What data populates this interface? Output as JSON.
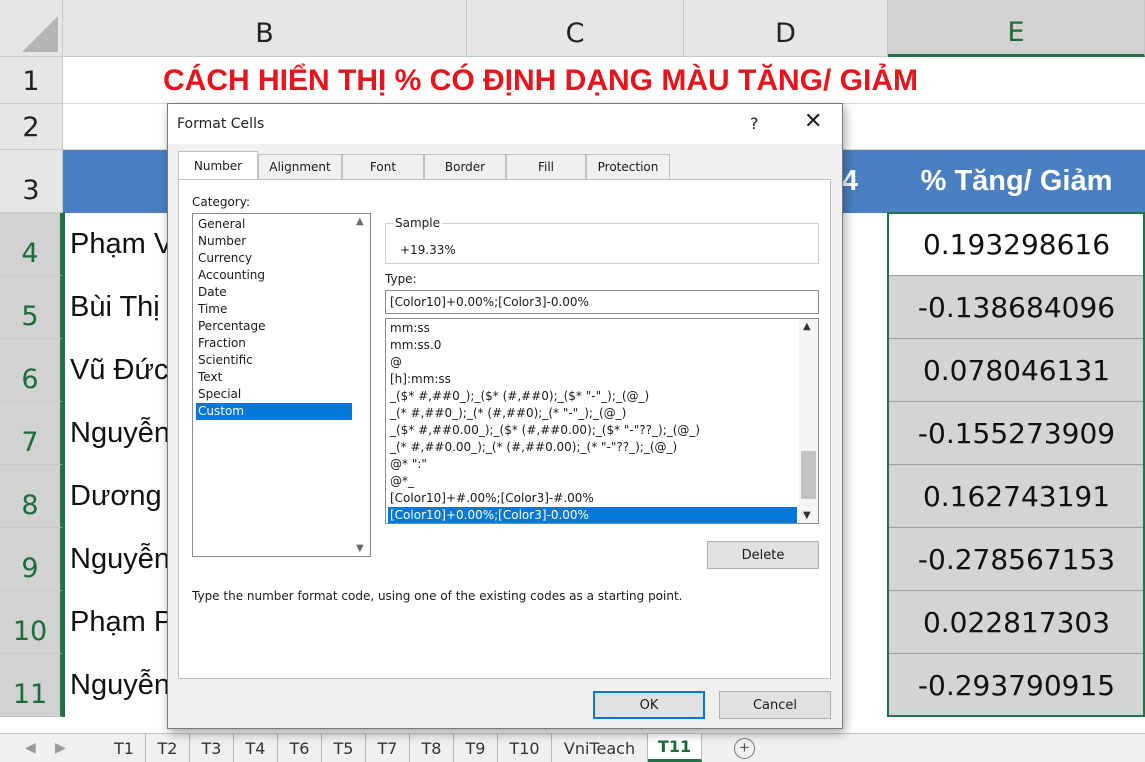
{
  "sheet": {
    "columns": [
      "B",
      "C",
      "D",
      "E"
    ],
    "selected_column": "E",
    "rows": [
      "1",
      "2",
      "3",
      "4",
      "5",
      "6",
      "7",
      "8",
      "9",
      "10",
      "11"
    ],
    "title": "CÁCH HIỂN THỊ % CÓ ĐỊNH DẠNG MÀU TĂNG/ GIẢM",
    "header_fragment_d": "4",
    "header_e": "% Tăng/ Giảm",
    "names": [
      "Phạm V",
      "Bùi Thị",
      "Vũ Đức",
      "Nguyễn",
      "Dương",
      "Nguyễn",
      "Phạm P",
      "Nguyễn"
    ],
    "values": [
      "0.193298616",
      "-0.138684096",
      "0.078046131",
      "-0.155273909",
      "0.162743191",
      "-0.278567153",
      "0.022817303",
      "-0.293790915"
    ],
    "accent_green": "#217346",
    "header_blue": "#4a7fc1",
    "title_red": "#e8141b"
  },
  "sheet_tabs": {
    "tabs": [
      "T1",
      "T2",
      "T3",
      "T4",
      "T6",
      "T5",
      "T7",
      "T8",
      "T9",
      "T10",
      "VniTeach",
      "T11"
    ],
    "active": "T11",
    "add_icon": "plus-circle-icon",
    "nav_icons": [
      "tab-prev-icon",
      "tab-next-icon"
    ]
  },
  "dialog": {
    "title": "Format Cells",
    "help": "?",
    "close_icon": "close-icon",
    "tabs": [
      "Number",
      "Alignment",
      "Font",
      "Border",
      "Fill",
      "Protection"
    ],
    "active_tab": "Number",
    "category_label": "Category:",
    "categories": [
      "General",
      "Number",
      "Currency",
      "Accounting",
      "Date",
      "Time",
      "Percentage",
      "Fraction",
      "Scientific",
      "Text",
      "Special",
      "Custom"
    ],
    "selected_category": "Custom",
    "sample_label": "Sample",
    "sample_value": "+19.33%",
    "type_label": "Type:",
    "type_value": "[Color10]+0.00%;[Color3]-0.00%",
    "formats": [
      "mm:ss",
      "mm:ss.0",
      "@",
      "[h]:mm:ss",
      "_($* #,##0_);_($* (#,##0);_($* \"-\"_);_(@_)",
      "_(* #,##0_);_(* (#,##0);_(* \"-\"_);_(@_)",
      "_($* #,##0.00_);_($* (#,##0.00);_($* \"-\"??_);_(@_)",
      "_(* #,##0.00_);_(* (#,##0.00);_(* \"-\"??_);_(@_)",
      "@* \":\"",
      "@*_",
      "[Color10]+#.00%;[Color3]-#.00%",
      "[Color10]+0.00%;[Color3]-0.00%"
    ],
    "selected_format": "[Color10]+0.00%;[Color3]-0.00%",
    "delete_label": "Delete",
    "hint": "Type the number format code, using one of the existing codes as a starting point.",
    "ok_label": "OK",
    "cancel_label": "Cancel",
    "selection_blue": "#0078d7"
  }
}
